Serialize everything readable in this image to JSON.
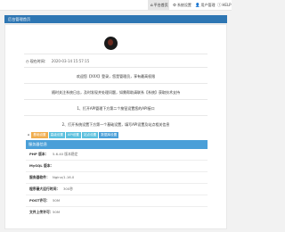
{
  "topnav": {
    "items": [
      {
        "label": "平台首页",
        "icon": "home-icon",
        "glyph": "⌂",
        "active": true
      },
      {
        "label": "系统设置",
        "icon": "gear-icon",
        "glyph": "⚙",
        "active": false
      },
      {
        "label": "用户管理",
        "icon": "user-icon",
        "glyph": "👤",
        "active": false
      },
      {
        "label": "HELP",
        "icon": "help-icon",
        "glyph": "ⓘ",
        "active": false
      }
    ]
  },
  "header": {
    "title": "后台管理首页"
  },
  "welcome": {
    "login_label": "现在时间：",
    "login_time": "2020-03-14 15:57:15",
    "lines": [
      "欢迎您【XXX】登录，您是管理员，享有最高权限",
      "随时关注系统日志，及时发现并处理问题，如需帮助请联系【系统】获取技术支持",
      "1、打开API管理下方第二个按钮设置您的API接口",
      "2、打开系统设置下方第一个基础设置，填写API设置及站点相关信息"
    ]
  },
  "tags": {
    "home_label": "⌂",
    "items": [
      {
        "label": "基础设置",
        "color": "#f0ad4e"
      },
      {
        "label": "高级设置",
        "color": "#5bc0de"
      },
      {
        "label": "API设置",
        "color": "#5bc0de"
      },
      {
        "label": "站点设置",
        "color": "#5bc0de"
      },
      {
        "label": "数据库设置",
        "color": "#4a9fd8"
      }
    ]
  },
  "server": {
    "title": "服务器信息",
    "rows": [
      {
        "key": "PHP 版本：",
        "value": "5.6.40 版本稳定"
      },
      {
        "key": "MySQL 版本：",
        "value": ""
      },
      {
        "key": "服务器软件：",
        "value": "Nginx/1.16.0"
      },
      {
        "key": "程序最大运行时间：",
        "value": "300秒"
      },
      {
        "key": "POST许可：",
        "value": "50M"
      },
      {
        "key": "文件上传许可：",
        "value": "50M"
      }
    ]
  }
}
